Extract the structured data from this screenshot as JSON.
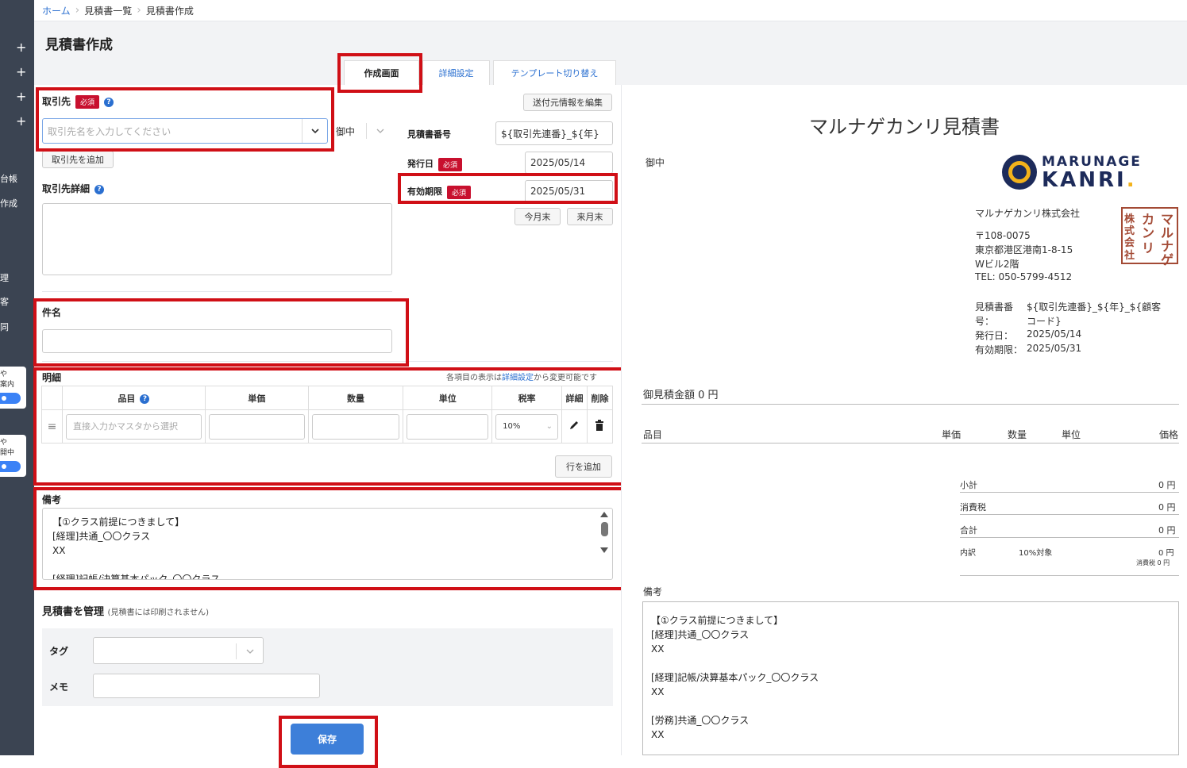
{
  "breadcrumb": {
    "home": "ホーム",
    "list": "見積書一覧",
    "current": "見積書作成"
  },
  "page": {
    "title": "見積書作成"
  },
  "sidebar": {
    "plus": "+",
    "t1": "台帳",
    "t2": "作成",
    "t3": "理",
    "t4": "客",
    "t5": "同",
    "card1a": "や",
    "card1b": "案内",
    "card2a": "や",
    "card2b": "開中"
  },
  "tabs": {
    "create": "作成画面",
    "detail": "詳細設定",
    "template": "テンプレート切り替え"
  },
  "client": {
    "label": "取引先",
    "required": "必須",
    "placeholder": "取引先名を入力してください",
    "honorific": "御中",
    "add_button": "取引先を追加",
    "detail_label": "取引先詳細"
  },
  "sender": {
    "edit_button": "送付元情報を編集"
  },
  "estimate": {
    "number_label": "見積書番号",
    "number_value": "${取引先連番}_${年}",
    "issue_label": "発行日",
    "issue_value": "2025/05/14",
    "expiry_label": "有効期限",
    "expiry_value": "2025/05/31",
    "this_month_button": "今月末",
    "next_month_button": "来月末"
  },
  "subject": {
    "label": "件名"
  },
  "items": {
    "label": "明細",
    "hint_prefix": "各項目の表示は",
    "hint_link": "詳細設定",
    "hint_suffix": "から変更可能です",
    "headers": [
      "品目",
      "単価",
      "数量",
      "単位",
      "税率",
      "詳細",
      "削除"
    ],
    "item_placeholder": "直接入力かマスタから選択",
    "tax_value": "10%",
    "add_row_button": "行を追加"
  },
  "memo": {
    "label": "備考",
    "lines": [
      "【①クラス前提につきまして】",
      "[経理]共通_〇〇クラス",
      "XX",
      "",
      "[経理]記帳/決算基本パック_〇〇クラス"
    ]
  },
  "manage": {
    "label": "見積書を管理",
    "note": "(見積書には印刷されません)",
    "tag_label": "タグ",
    "memo_label": "メモ"
  },
  "save_button": "保存",
  "preview": {
    "title": "マルナゲカンリ見積書",
    "honorific": "御中",
    "logo_line1": "MARUNAGE",
    "logo_line2": "KANRI",
    "logo_dot": ".",
    "company": "マルナゲカンリ株式会社",
    "postal": "〒108-0075",
    "address1": "東京都港区港南1-8-15",
    "address2": "Wビル2階",
    "tel": "TEL: 050-5799-4512",
    "seal_chars": [
      "株",
      "式",
      "会",
      "社",
      "マ",
      "ル",
      "ナ",
      "ゲ",
      "カ",
      "ン",
      "リ"
    ],
    "number_label1": "見積書番",
    "number_label2": "号：",
    "number_value1": "${取引先連番}_${年}_${顧客",
    "number_value2": "コード}",
    "issue_label": "発行日：",
    "issue_value": "2025/05/14",
    "expiry_label": "有効期限：",
    "expiry_value": "2025/05/31",
    "total_label": "御見積金額 0 円",
    "headers": {
      "item": "品目",
      "price": "単価",
      "qty": "数量",
      "unit": "単位",
      "amount": "価格"
    },
    "subtotal_label": "小計",
    "subtotal_value": "0 円",
    "tax_label": "消費税",
    "tax_value": "0 円",
    "sum_label": "合計",
    "sum_value": "0 円",
    "breakdown_label": "内訳",
    "breakdown_rate": "10%対象",
    "breakdown_value": "0 円",
    "breakdown_tax": "消費税 0 円",
    "memo_label": "備考",
    "memo_lines": [
      "【①クラス前提につきまして】",
      "[経理]共通_〇〇クラス",
      "XX",
      "",
      "[経理]記帳/決算基本パック_〇〇クラス",
      "XX",
      "",
      "[労務]共通_〇〇クラス",
      "XX"
    ]
  },
  "colors": {
    "highlight": "#d00f16",
    "primary": "#3d7fd9",
    "required": "#c8102e",
    "sidebar": "#3b4452"
  }
}
